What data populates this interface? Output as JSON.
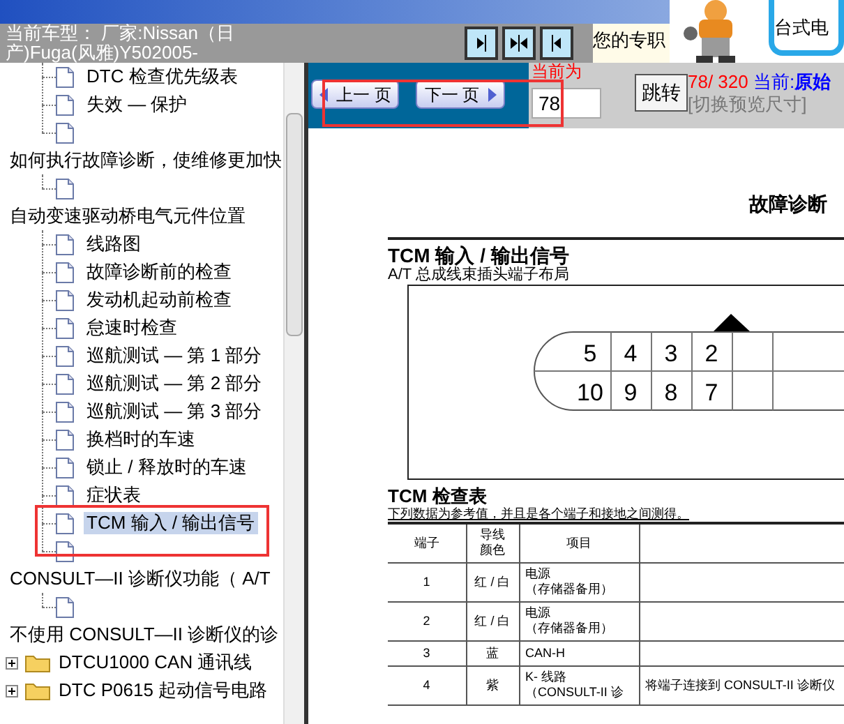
{
  "header": {
    "car_model": "当前车型： 厂家:Nissan（日产)Fuga(风雅)Y502005-",
    "promo_text": "您的专职",
    "ad_text": "台式电"
  },
  "tree": {
    "nodes": [
      {
        "kind": "group",
        "children": [
          {
            "kind": "page",
            "label": "DTC 检查优先级表",
            "selected": false,
            "marked": false
          },
          {
            "kind": "page",
            "label": "失效 — 保护",
            "selected": false,
            "marked": false
          },
          {
            "kind": "page",
            "selected": false,
            "marked": false
          }
        ]
      },
      {
        "kind": "heading",
        "label": "如何执行故障诊断，使维修更加快",
        "children": [
          {
            "kind": "page",
            "selected": false,
            "marked": false
          }
        ]
      },
      {
        "kind": "heading",
        "label": "自动变速驱动桥电气元件位置",
        "children": [
          {
            "kind": "page",
            "label": "线路图",
            "selected": false,
            "marked": false
          },
          {
            "kind": "page",
            "label": "故障诊断前的检查",
            "selected": false,
            "marked": false
          },
          {
            "kind": "page",
            "label": "发动机起动前检查",
            "selected": false,
            "marked": false
          },
          {
            "kind": "page",
            "label": "怠速时检查",
            "selected": false,
            "marked": false
          },
          {
            "kind": "page",
            "label": "巡航测试 — 第 1 部分",
            "selected": false,
            "marked": false
          },
          {
            "kind": "page",
            "label": "巡航测试 — 第 2 部分",
            "selected": false,
            "marked": false
          },
          {
            "kind": "page",
            "label": "巡航测试 — 第 3 部分",
            "selected": false,
            "marked": false
          },
          {
            "kind": "page",
            "label": "换档时的车速",
            "selected": false,
            "marked": false
          },
          {
            "kind": "page",
            "label": "锁止 / 释放时的车速",
            "selected": false,
            "marked": false
          },
          {
            "kind": "page",
            "label": "症状表",
            "selected": false,
            "marked": false
          },
          {
            "kind": "page",
            "label": "TCM 输入 / 输出信号",
            "selected": true,
            "marked": true
          },
          {
            "kind": "page",
            "selected": false,
            "marked": false
          }
        ]
      },
      {
        "kind": "heading",
        "label": "CONSULT—II 诊断仪功能（ A/T",
        "children": [
          {
            "kind": "page",
            "selected": false,
            "marked": false
          }
        ]
      },
      {
        "kind": "heading",
        "label": "不使用 CONSULT—II 诊断仪的诊",
        "children": [
          {
            "kind": "folder",
            "label": "DTCU1000 CAN 通讯线",
            "expanded": false
          },
          {
            "kind": "folder",
            "label": "DTC P0615 起动信号电路",
            "expanded": false
          }
        ]
      }
    ]
  },
  "pager": {
    "prev": "上一 页",
    "next": "下一 页",
    "marked": true,
    "current_label": "当前为",
    "page_input": "78",
    "jump": "跳转",
    "count": "78/ 320",
    "mode_label": "当前:",
    "mode": "原始",
    "resize_link": "[切换预览尺寸]"
  },
  "document": {
    "section": "故障诊断",
    "title": "TCM 输入 / 输出信号",
    "subtitle": "A/T 总成线束插头端子布局",
    "pins": [
      [
        "5",
        "4",
        "3",
        "2"
      ],
      [
        "10",
        "9",
        "8",
        "7"
      ]
    ],
    "table_title": "TCM 检查表",
    "table_note": "下列数据为参考值，并且是各个端子和接地之间测得。",
    "columns": [
      "端子",
      "导线颜色",
      "项目"
    ],
    "rows": [
      [
        [
          "1"
        ],
        [
          "红 / 白"
        ],
        [
          "电源",
          "（存储器备用）"
        ]
      ],
      [
        [
          "2"
        ],
        [
          "红 / 白"
        ],
        [
          "电源",
          "（存储器备用）"
        ]
      ],
      [
        [
          "3"
        ],
        [
          "蓝"
        ],
        [
          "CAN-H"
        ]
      ],
      [
        [
          "4"
        ],
        [
          "紫"
        ],
        [
          "K- 线路",
          "（CONSULT-II 诊"
        ],
        [
          "将端子连接到 CONSULT-II 诊断仪"
        ]
      ]
    ]
  }
}
